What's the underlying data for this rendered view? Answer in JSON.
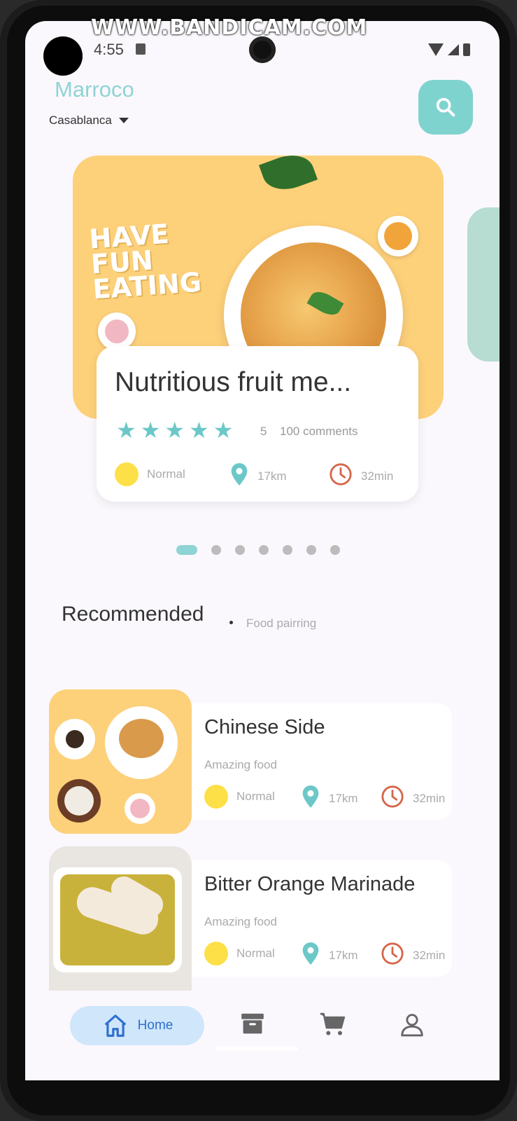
{
  "watermark": "WWW.BANDICAM.COM",
  "status": {
    "time": "4:55"
  },
  "header": {
    "title": "Marroco",
    "location": "Casablanca"
  },
  "banner": {
    "text_lines": [
      "HAVE",
      "FUN",
      "EATING"
    ]
  },
  "featured": {
    "title": "Nutritious fruit me...",
    "stars": 5,
    "rating": "5",
    "comments": "100 comments",
    "level": "Normal",
    "distance": "17km",
    "time": "32min"
  },
  "pager": {
    "count": 7,
    "active": 0
  },
  "recommended": {
    "title": "Recommended",
    "subtitle": "Food pairring"
  },
  "items": [
    {
      "title": "Chinese Side",
      "subtitle": "Amazing food",
      "level": "Normal",
      "distance": "17km",
      "time": "32min"
    },
    {
      "title": "Bitter Orange Marinade",
      "subtitle": "Amazing food",
      "level": "Normal",
      "distance": "17km",
      "time": "32min"
    }
  ],
  "nav": {
    "home_label": "Home",
    "icons": [
      "home-icon",
      "archive-icon",
      "cart-icon",
      "profile-icon"
    ]
  },
  "colors": {
    "accent": "#7fd3cf",
    "star": "#6cc8c8",
    "dot_yellow": "#fde047",
    "pin": "#6cc8c8",
    "clock": "#d5664a",
    "nav_active_bg": "#cfe6fb"
  }
}
